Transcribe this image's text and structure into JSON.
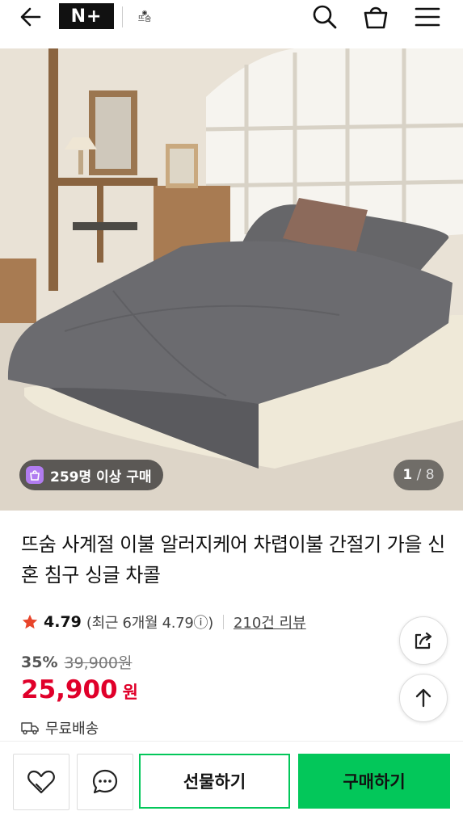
{
  "header": {
    "logo": "N+",
    "brand": "뜨숨",
    "icons": [
      "back-arrow-icon",
      "search-icon",
      "shopping-bag-icon",
      "menu-icon"
    ]
  },
  "hero": {
    "purchase_badge": "259명 이상 구매",
    "image_index": "1",
    "image_total": "8"
  },
  "product": {
    "title": "뜨숨 사계절 이불 알러지케어 차렵이불 간절기 가을 신혼 침구 싱글 차콜",
    "rating": "4.79",
    "recent_rating": "(최근 6개월 4.79ⓘ)",
    "review_count": "210건 리뷰",
    "discount": "35%",
    "original_price": "39,900원",
    "sale_price": "25,900",
    "currency": "원",
    "shipping": "무료배송"
  },
  "bottom_bar": {
    "gift_label": "선물하기",
    "buy_label": "구매하기"
  },
  "colors": {
    "accent_green": "#03c75a",
    "price_red": "#e0002a",
    "star": "#e8442a"
  }
}
